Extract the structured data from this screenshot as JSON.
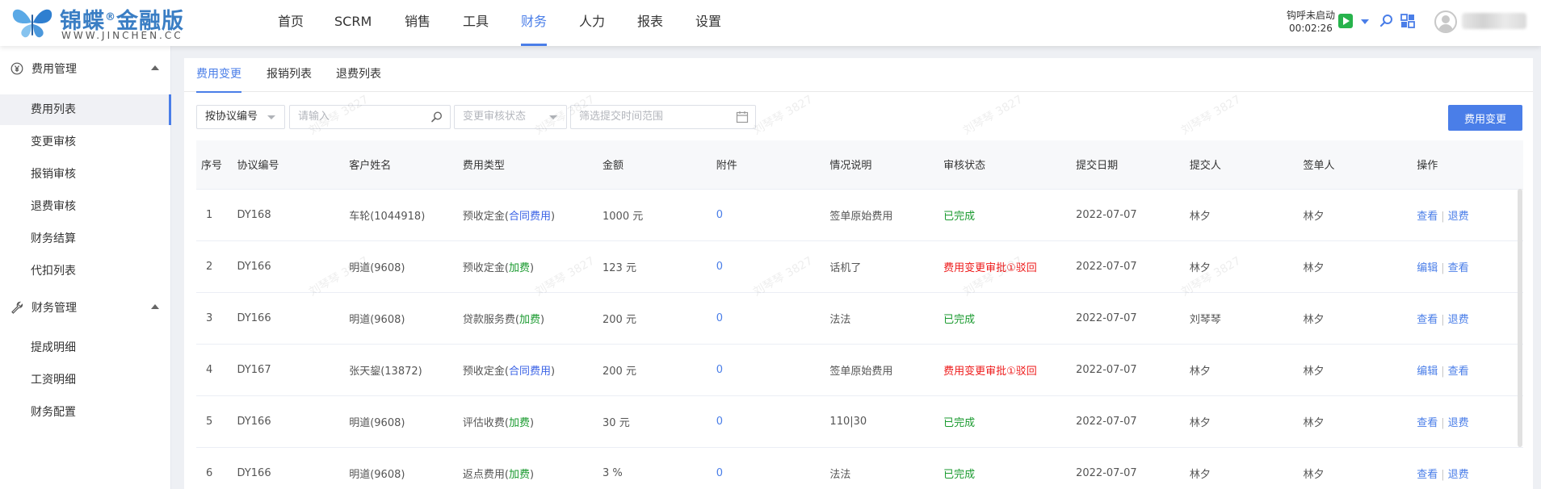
{
  "header": {
    "logo_text": "锦蝶",
    "logo_reg": "®",
    "logo_text2": "金融版",
    "logo_sub": "WWW.JINCHEN.CC",
    "nav": [
      "首页",
      "SCRM",
      "销售",
      "工具",
      "财务",
      "人力",
      "报表",
      "设置"
    ],
    "active_nav": "财务",
    "call_status": "钩呼未启动",
    "call_timer": "00:02:26"
  },
  "sidebar": {
    "groups": [
      {
        "label": "费用管理",
        "icon": "yen-circle-icon",
        "items": [
          "费用列表",
          "变更审核",
          "报销审核",
          "退费审核",
          "财务结算",
          "代扣列表"
        ]
      },
      {
        "label": "财务管理",
        "icon": "wrench-icon",
        "items": [
          "提成明细",
          "工资明细",
          "财务配置"
        ]
      }
    ],
    "active_item": "费用列表"
  },
  "tabs": [
    "费用变更",
    "报销列表",
    "退费列表"
  ],
  "active_tab": "费用变更",
  "filters": {
    "protocol_select": "按协议编号",
    "search_placeholder": "请输入",
    "status_placeholder": "变更审核状态",
    "date_placeholder": "筛选提交时间范围"
  },
  "primary_button": "费用变更",
  "table": {
    "columns": [
      "序号",
      "协议编号",
      "客户姓名",
      "费用类型",
      "金额",
      "附件",
      "情况说明",
      "审核状态",
      "提交日期",
      "提交人",
      "签单人",
      "操作"
    ],
    "rows": [
      {
        "no": "1",
        "protocol": "DY168",
        "customer": "车轮(1044918)",
        "type_main": "预收定金(",
        "type_tag": "合同费用",
        "type_tag_color": "blue",
        "type_end": ")",
        "amount": "1000 元",
        "attach": "0",
        "note": "签单原始费用",
        "status": "已完成",
        "status_color": "green",
        "date": "2022-07-07",
        "submitter": "林夕",
        "signer": "林夕",
        "op1": "查看",
        "op2": "退费"
      },
      {
        "no": "2",
        "protocol": "DY166",
        "customer": "明道(9608)",
        "type_main": "预收定金(",
        "type_tag": "加费",
        "type_tag_color": "green",
        "type_end": ")",
        "amount": "123 元",
        "attach": "0",
        "note": "话机了",
        "status": "费用变更审批①驳回",
        "status_color": "red",
        "date": "2022-07-07",
        "submitter": "林夕",
        "signer": "林夕",
        "op1": "编辑",
        "op2": "查看"
      },
      {
        "no": "3",
        "protocol": "DY166",
        "customer": "明道(9608)",
        "type_main": "贷款服务费(",
        "type_tag": "加费",
        "type_tag_color": "green",
        "type_end": ")",
        "amount": "200 元",
        "attach": "0",
        "note": "法法",
        "status": "已完成",
        "status_color": "green",
        "date": "2022-07-07",
        "submitter": "刘琴琴",
        "signer": "林夕",
        "op1": "查看",
        "op2": "退费"
      },
      {
        "no": "4",
        "protocol": "DY167",
        "customer": "张天鋆(13872)",
        "type_main": "预收定金(",
        "type_tag": "合同费用",
        "type_tag_color": "blue",
        "type_end": ")",
        "amount": "200 元",
        "attach": "0",
        "note": "签单原始费用",
        "status": "费用变更审批①驳回",
        "status_color": "red",
        "date": "2022-07-07",
        "submitter": "林夕",
        "signer": "林夕",
        "op1": "编辑",
        "op2": "查看"
      },
      {
        "no": "5",
        "protocol": "DY166",
        "customer": "明道(9608)",
        "type_main": "评估收费(",
        "type_tag": "加费",
        "type_tag_color": "green",
        "type_end": ")",
        "amount": "30 元",
        "attach": "0",
        "note": "110|30",
        "status": "已完成",
        "status_color": "green",
        "date": "2022-07-07",
        "submitter": "林夕",
        "signer": "林夕",
        "op1": "查看",
        "op2": "退费"
      },
      {
        "no": "6",
        "protocol": "DY166",
        "customer": "明道(9608)",
        "type_main": "返点费用(",
        "type_tag": "加费",
        "type_tag_color": "green",
        "type_end": ")",
        "amount": "3 %",
        "attach": "0",
        "note": "法法",
        "status": "已完成",
        "status_color": "green",
        "date": "2022-07-07",
        "submitter": "林夕",
        "signer": "林夕",
        "op1": "查看",
        "op2": "退费"
      }
    ]
  },
  "watermark": "刘琴琴 3827",
  "colors": {
    "accent": "#4a7ee8",
    "green": "#1a9a2f",
    "red": "#ee1b1b",
    "blue_tag": "#3b63e6"
  }
}
